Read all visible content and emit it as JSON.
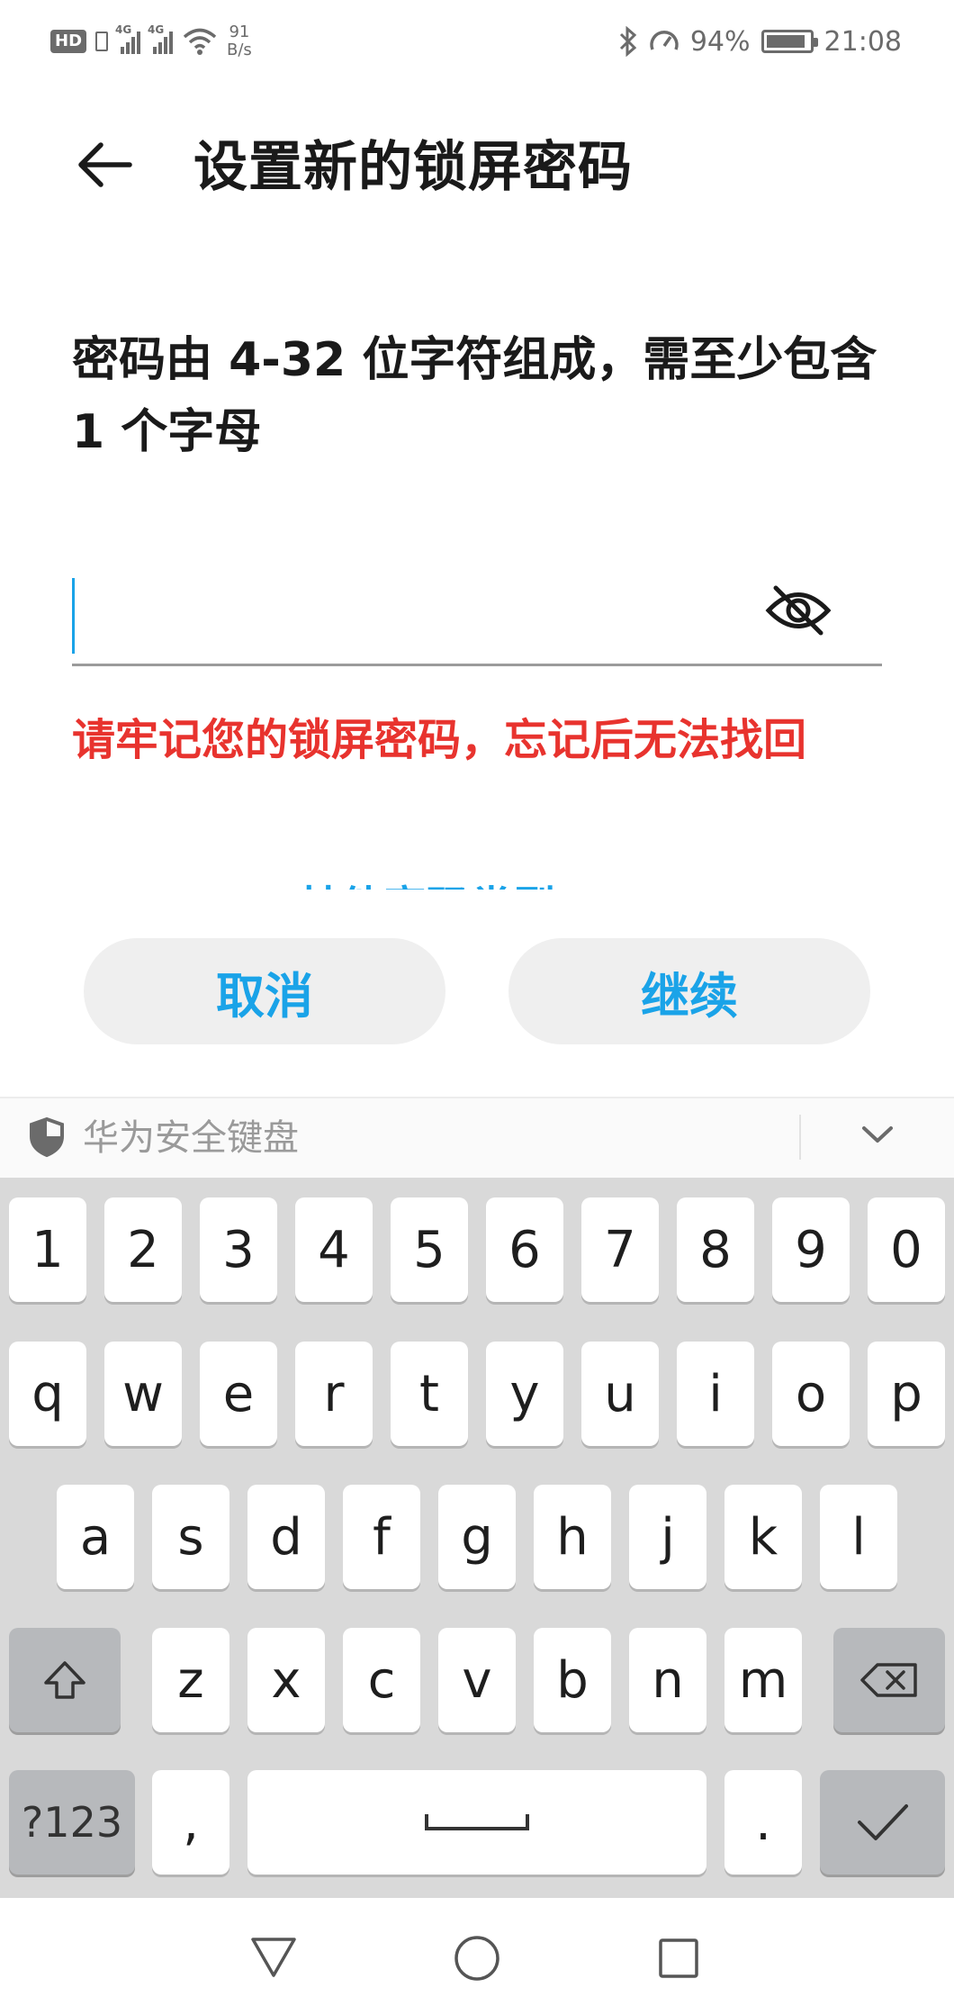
{
  "status_bar": {
    "hd_badge": "HD",
    "sim1_label": "4G",
    "sim2_label": "4G",
    "net_speed_value": "91",
    "net_speed_unit": "B/s",
    "battery_percent": "94%",
    "time": "21:08"
  },
  "header": {
    "title": "设置新的锁屏密码",
    "back_icon": "back-arrow-icon"
  },
  "description": "密码由 4-32 位字符组成，需至少包含 1 个字母",
  "password_input": {
    "value": "",
    "toggle_icon": "eye-hidden-icon"
  },
  "warning_text": "请牢记您的锁屏密码，忘记后无法找回",
  "other_type_link": "其他密码类型",
  "buttons": {
    "cancel": "取消",
    "continue": "继续"
  },
  "keyboard": {
    "title": "华为安全键盘",
    "shield_icon": "shield-icon",
    "collapse_icon": "chevron-down-icon",
    "row_numbers": [
      "1",
      "2",
      "3",
      "4",
      "5",
      "6",
      "7",
      "8",
      "9",
      "0"
    ],
    "row_q": [
      "q",
      "w",
      "e",
      "r",
      "t",
      "y",
      "u",
      "i",
      "o",
      "p"
    ],
    "row_a": [
      "a",
      "s",
      "d",
      "f",
      "g",
      "h",
      "j",
      "k",
      "l"
    ],
    "row_z": [
      "z",
      "x",
      "c",
      "v",
      "b",
      "n",
      "m"
    ],
    "shift_icon": "shift-icon",
    "delete_icon": "backspace-icon",
    "symbols_key": "?123",
    "comma_key": ",",
    "space_icon": "space-icon",
    "period_key": ".",
    "enter_icon": "checkmark-icon"
  },
  "nav_bar": {
    "back_icon": "nav-back-triangle-icon",
    "home_icon": "nav-home-circle-icon",
    "recents_icon": "nav-recents-square-icon"
  },
  "colors": {
    "accent": "#1aa3e8",
    "warning": "#e8332e",
    "button_bg": "#efefef",
    "keyboard_bg": "#d9d9d9",
    "key_dark": "#b7b9bc"
  }
}
